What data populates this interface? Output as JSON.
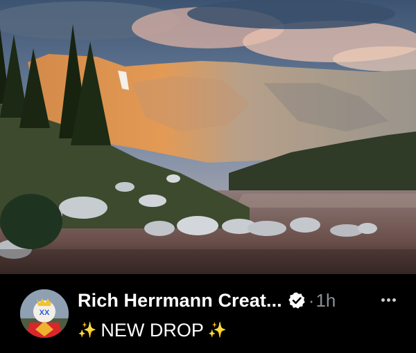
{
  "post": {
    "author_name": "Rich Herrmann Creat...",
    "separator": "·",
    "time": "1h",
    "message_prefix_emoji": "✨",
    "message": "NEW DROP",
    "message_suffix_emoji": "✨"
  },
  "icons": {
    "verified": "verified-badge-icon",
    "more": "more-options-icon",
    "avatar": "avatar"
  },
  "colors": {
    "background": "#000000",
    "text": "#ffffff",
    "muted": "#8b8f94",
    "sparkle": "#ffd23f"
  }
}
